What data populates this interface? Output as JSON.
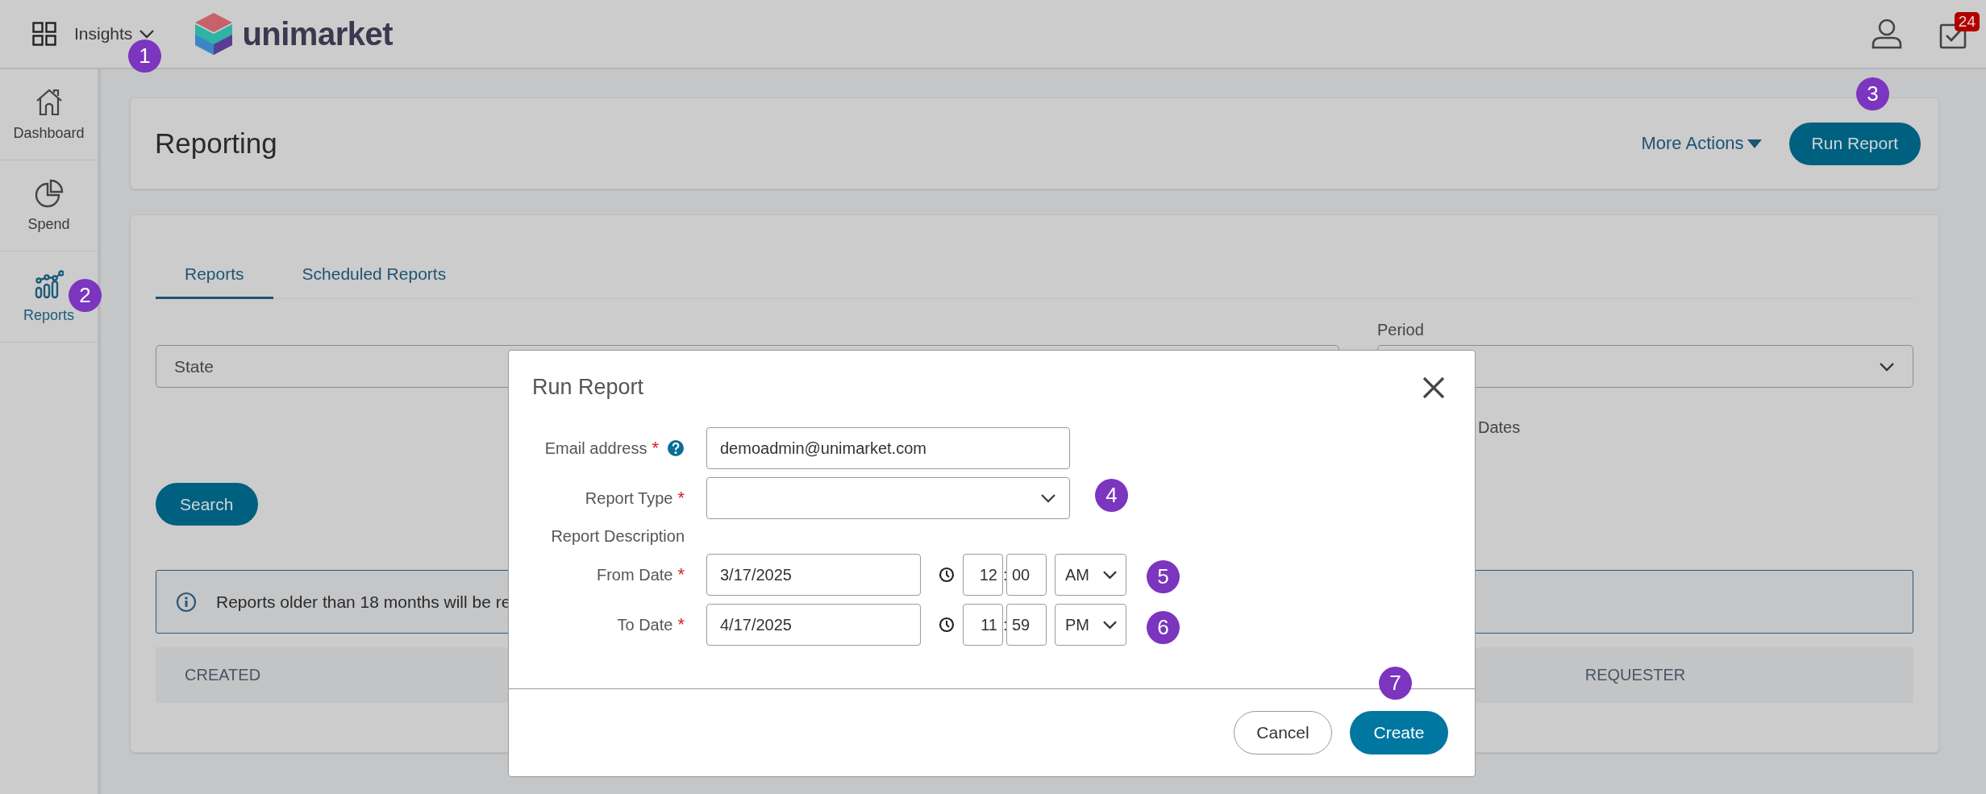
{
  "header": {
    "app_menu": "Insights",
    "logo_text": "unimarket",
    "task_count": "24"
  },
  "sidebar": {
    "items": [
      {
        "label": "Dashboard",
        "selected": false
      },
      {
        "label": "Spend",
        "selected": false
      },
      {
        "label": "Reports",
        "selected": true
      }
    ]
  },
  "page_header": {
    "title": "Reporting",
    "more_actions": "More Actions",
    "primary_button": "Run Report"
  },
  "tabs": [
    {
      "label": "Reports",
      "selected": true
    },
    {
      "label": "Scheduled Reports",
      "selected": false
    }
  ],
  "filters": {
    "state_select": "State",
    "period_label": "Period",
    "dates_label": "Dates"
  },
  "search_button": "Search",
  "info_message": "Reports older than 18 months will be re",
  "table": {
    "columns": [
      "CREATED",
      "REQUESTER"
    ]
  },
  "dialog": {
    "title": "Run Report",
    "required_mark": "*",
    "fields": [
      {
        "kind": "text",
        "label": "Email address",
        "required": true,
        "help": true,
        "value": "demoadmin@unimarket.com"
      },
      {
        "kind": "select",
        "label": "Report Type",
        "required": true
      },
      {
        "kind": "heading",
        "label": "Report Description"
      },
      {
        "kind": "datetime",
        "label": "From Date",
        "required": true,
        "date": "3/17/2025",
        "hour": "12",
        "separator": ":",
        "minute": "00",
        "meridiem": "AM"
      },
      {
        "kind": "datetime",
        "label": "To Date",
        "required": true,
        "date": "4/17/2025",
        "hour": "11",
        "separator": ":",
        "minute": "59",
        "meridiem": "PM"
      }
    ],
    "buttons": [
      {
        "label": "Cancel",
        "kind": "secondary"
      },
      {
        "label": "Create",
        "kind": "primary"
      }
    ]
  },
  "callouts": [
    "1",
    "2",
    "3",
    "4",
    "5",
    "6",
    "7"
  ]
}
